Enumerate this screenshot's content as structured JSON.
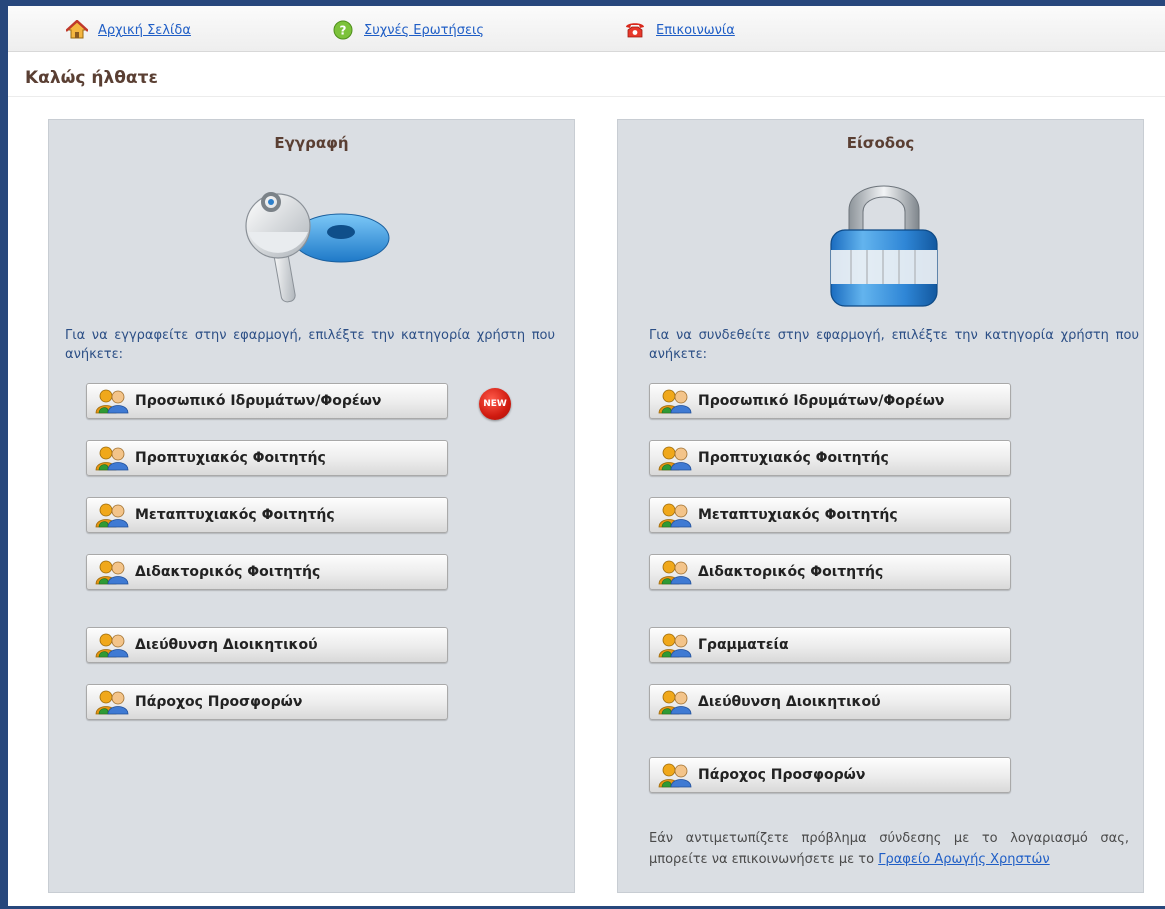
{
  "nav": {
    "home_label": "Αρχική Σελίδα",
    "faq_label": "Συχνές Ερωτήσεις",
    "contact_label": "Επικοινωνία"
  },
  "page": {
    "title": "Καλώς ήλθατε"
  },
  "register": {
    "heading": "Εγγραφή",
    "instructions": "Για να εγγραφείτε στην εφαρμογή, επιλέξτε την κατηγορία χρήστη που ανήκετε:",
    "new_badge": "NEW",
    "buttons": [
      "Προσωπικό Ιδρυμάτων/Φορέων",
      "Προπτυχιακός Φοιτητής",
      "Μεταπτυχιακός Φοιτητής",
      "Διδακτορικός Φοιτητής",
      "Διεύθυνση Διοικητικού",
      "Πάροχος Προσφορών"
    ]
  },
  "login": {
    "heading": "Είσοδος",
    "instructions": "Για να συνδεθείτε στην εφαρμογή, επιλέξτε την κατηγορία χρήστη που ανήκετε:",
    "buttons": [
      "Προσωπικό Ιδρυμάτων/Φορέων",
      "Προπτυχιακός Φοιτητής",
      "Μεταπτυχιακός Φοιτητής",
      "Διδακτορικός Φοιτητής",
      "Γραμματεία",
      "Διεύθυνση Διοικητικού",
      "Πάροχος Προσφορών"
    ],
    "help_text": "Εάν αντιμετωπίζετε πρόβλημα σύνδεσης με το λογαριασμό σας, μπορείτε να επικοινωνήσετε με το",
    "help_link": "Γραφείο Αρωγής Χρηστών"
  },
  "colors": {
    "frame": "#27477c",
    "panel_bg": "#dadee3",
    "link": "#1f5ec6",
    "heading": "#5a3f33",
    "instructions": "#2c4f86"
  },
  "icons": {
    "home": "house-icon",
    "faq": "question-icon",
    "contact": "telephone-icon",
    "register_graphic": "keys-icon",
    "login_graphic": "padlock-icon",
    "user_category": "users-icon"
  }
}
